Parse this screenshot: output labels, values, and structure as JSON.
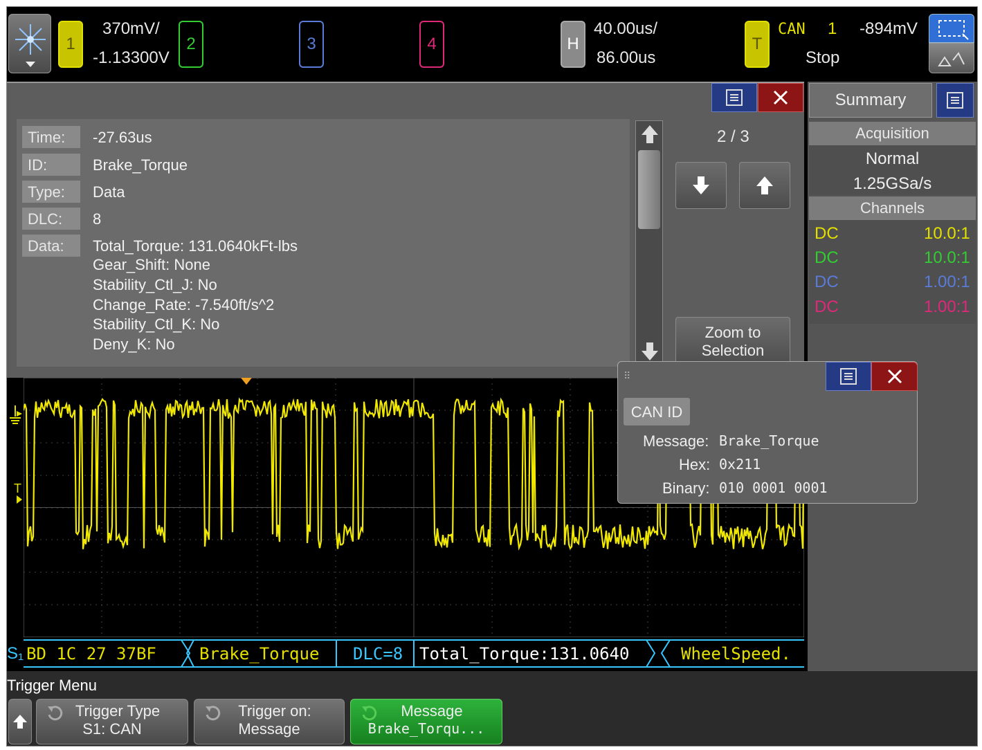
{
  "topbar": {
    "ch1": {
      "label": "1",
      "scale": "370mV/",
      "offset": "-1.13300V",
      "color": "#e3e000"
    },
    "ch2": {
      "label": "2",
      "color": "#33cc33"
    },
    "ch3": {
      "label": "3",
      "color": "#5a7bd8"
    },
    "ch4": {
      "label": "4",
      "color": "#e0287a"
    },
    "horizontal": {
      "label": "H",
      "time_scale": "40.00us/",
      "delay": "86.00us"
    },
    "trigger": {
      "label": "T",
      "source": "CAN",
      "channel": "1",
      "level": "-894mV",
      "state": "Stop"
    }
  },
  "lister": {
    "position": "2 / 3",
    "fields": [
      {
        "label": "Time:",
        "value": "-27.63us"
      },
      {
        "label": "ID:",
        "value": "Brake_Torque"
      },
      {
        "label": "Type:",
        "value": "Data"
      },
      {
        "label": "DLC:",
        "value": "8"
      },
      {
        "label": "Data:",
        "value": "Total_Torque: 131.0640kFt-lbs"
      }
    ],
    "data_lines": [
      "Gear_Shift: None",
      "Stability_Ctl_J: No",
      "Change_Rate: -7.540ft/s^2",
      "Stability_Ctl_K: No",
      "Deny_K: No"
    ],
    "zoom_label_1": "Zoom to",
    "zoom_label_2": "Selection"
  },
  "summary": {
    "tab": "Summary",
    "acquisition_header": "Acquisition",
    "mode": "Normal",
    "rate": "1.25GSa/s",
    "channels_header": "Channels",
    "channels": [
      {
        "coupling": "DC",
        "probe": "10.0:1",
        "color": "#e3e000"
      },
      {
        "coupling": "DC",
        "probe": "10.0:1",
        "color": "#33cc33"
      },
      {
        "coupling": "DC",
        "probe": "1.00:1",
        "color": "#5a7bd8"
      },
      {
        "coupling": "DC",
        "probe": "1.00:1",
        "color": "#e0287a"
      }
    ]
  },
  "popup": {
    "title": "CAN ID",
    "message_label": "Message:",
    "message_value": "Brake_Torque",
    "hex_label": "Hex:",
    "hex_value": "0x211",
    "binary_label": "Binary:",
    "binary_value": "010 0001 0001"
  },
  "decode": {
    "prefix": "BD 1C 27 37BF",
    "id": "Brake_Torque",
    "dlc": "DLC=8",
    "data": "Total_Torque:131.0640",
    "next": "WheelSpeed."
  },
  "softkeys": {
    "menu_title": "Trigger Menu",
    "k1_line1": "Trigger Type",
    "k1_line2": "S1: CAN",
    "k2_line1": "Trigger on:",
    "k2_line2": "Message",
    "k3_line1": "Message",
    "k3_line2": "Brake_Torqu..."
  },
  "colors": {
    "trace": "#f0e800",
    "decode_cyan": "#39c6ff",
    "softkey_active": "#1f9a2b"
  }
}
